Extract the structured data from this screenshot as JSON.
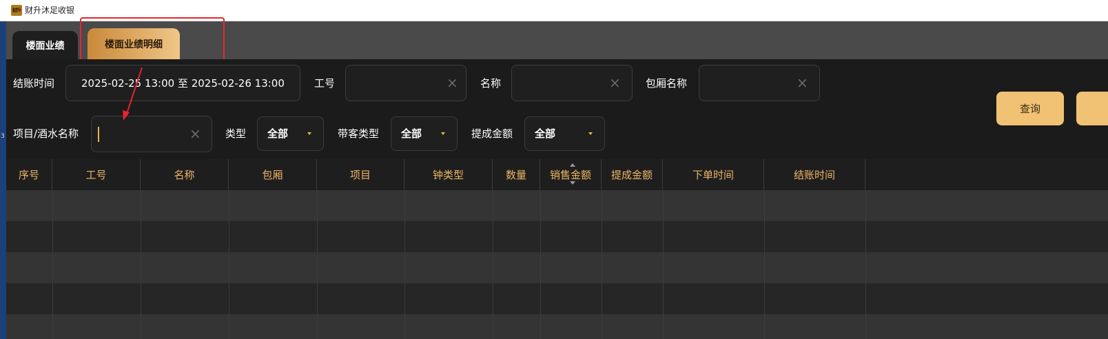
{
  "app": {
    "title": "财升沐足收银",
    "logo_text": "财升"
  },
  "left_strip_mark": "3",
  "tabs": [
    {
      "label": "楼面业绩",
      "active": false
    },
    {
      "label": "楼面业绩明细",
      "active": true
    }
  ],
  "filters": {
    "checkout_time": {
      "label": "结账时间",
      "value": "2025-02-25 13:00 至 2025-02-26 13:00"
    },
    "employee_id": {
      "label": "工号",
      "value": "",
      "clear_icon": "×"
    },
    "name": {
      "label": "名称",
      "value": "",
      "clear_icon": "×"
    },
    "room_name": {
      "label": "包厢名称",
      "value": "",
      "clear_icon": "×"
    },
    "item_name": {
      "label": "项目/酒水名称",
      "value": "",
      "clear_icon": "×"
    },
    "type": {
      "label": "类型",
      "selected": "全部"
    },
    "guest_type": {
      "label": "带客类型",
      "selected": "全部"
    },
    "commission_amount": {
      "label": "提成金额",
      "selected": "全部"
    }
  },
  "buttons": {
    "query": "查询"
  },
  "table": {
    "columns": [
      "序号",
      "工号",
      "名称",
      "包厢",
      "项目",
      "钟类型",
      "数量",
      "销售金额",
      "提成金额",
      "下单时间",
      "结账时间"
    ],
    "rows": []
  },
  "colors": {
    "accent": "#f1c274",
    "header_text": "#efb565",
    "annotation": "#e8252b"
  }
}
